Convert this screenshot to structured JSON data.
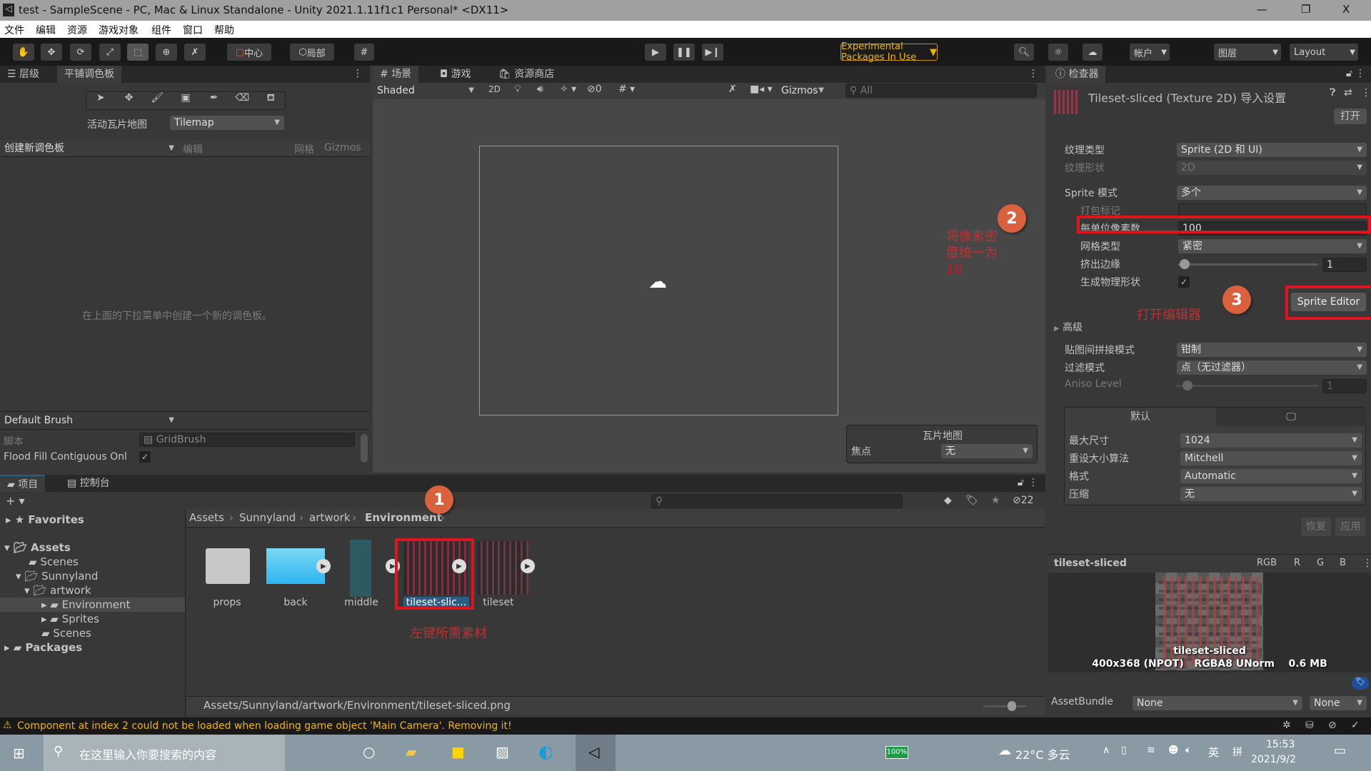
{
  "window": {
    "title": "test - SampleScene - PC, Mac & Linux Standalone - Unity 2021.1.11f1c1 Personal* <DX11>",
    "minimize": "—",
    "restore": "❐",
    "close": "X"
  },
  "menu": [
    "文件",
    "编辑",
    "资源",
    "游戏对象",
    "组件",
    "窗口",
    "帮助"
  ],
  "toolbar": {
    "pivot": "中心",
    "space": "局部",
    "experimental": "Experimental Packages In Use",
    "account": "帐户",
    "layers": "图层",
    "layout": "Layout"
  },
  "left_panel": {
    "tabs": [
      "层级",
      "平铺调色板"
    ],
    "active_tilemap_label": "活动瓦片地图",
    "active_tilemap_value": "Tilemap",
    "palette_dropdown": "创建新调色板",
    "edit": "编辑",
    "grid": "网格",
    "gizmos": "Gizmos",
    "empty_hint": "在上面的下拉菜单中创建一个新的调色板。",
    "brush": "Default Brush",
    "script_label": "脚本",
    "script_value": "GridBrush",
    "flood_fill_label": "Flood Fill Contiguous Onl",
    "flood_fill_checked": true
  },
  "scene": {
    "tabs": [
      "场景",
      "游戏",
      "资源商店"
    ],
    "shading": "Shaded",
    "mode_2d": "2D",
    "hidden_count": "0",
    "gizmos": "Gizmos",
    "search_placeholder": "All",
    "overlay": {
      "title": "瓦片地图",
      "focus_label": "焦点",
      "focus_value": "无"
    }
  },
  "annotations": {
    "step1": "1",
    "step1_text": "左键所需素材",
    "step2": "2",
    "step2_text_line1": "将像素密",
    "step2_text_line2": "度统一为",
    "step2_text_line3": "16",
    "step3": "3",
    "step3_text": "打开编辑器"
  },
  "inspector": {
    "tab": "检查器",
    "asset_title": "Tileset-sliced (Texture 2D) 导入设置",
    "open_button": "打开",
    "rows": [
      {
        "label": "纹理类型",
        "value": "Sprite (2D 和 UI)"
      },
      {
        "label": "纹理形状",
        "value": "2D"
      },
      {
        "label": "Sprite 模式",
        "value": "多个"
      },
      {
        "label": "打包标记",
        "value": ""
      },
      {
        "label": "每单位像素数",
        "value": "100"
      },
      {
        "label": "网格类型",
        "value": "紧密"
      },
      {
        "label": "挤出边缘",
        "value": "1"
      },
      {
        "label": "生成物理形状",
        "value": true
      }
    ],
    "extrude_slider": 0.0,
    "sprite_editor": "Sprite Editor",
    "advanced": "高级",
    "wrap_label": "贴图间拼接模式",
    "wrap_value": "钳制",
    "filter_label": "过滤模式",
    "filter_value": "点（无过滤器）",
    "aniso_label": "Aniso Level",
    "aniso_value": "1",
    "platform_tab": "默认",
    "platform_rows": [
      {
        "label": "最大尺寸",
        "value": "1024"
      },
      {
        "label": "重设大小算法",
        "value": "Mitchell"
      },
      {
        "label": "格式",
        "value": "Automatic"
      },
      {
        "label": "压缩",
        "value": "无"
      }
    ],
    "revert": "恢复",
    "apply": "应用",
    "preview_name": "tileset-sliced",
    "channels": [
      "RGB",
      "R",
      "G",
      "B"
    ],
    "preview_caption": "tileset-sliced",
    "preview_info": "400x368 (NPOT)   RGBA8 UNorm    0.6 MB",
    "assetbundle_label": "AssetBundle",
    "assetbundle_value": "None",
    "assetbundle_variant": "None"
  },
  "project": {
    "tabs": [
      "项目",
      "控制台"
    ],
    "hidden_count": "22",
    "tree": [
      {
        "label": "Favorites"
      },
      {
        "label": "Assets"
      },
      {
        "label": "Scenes"
      },
      {
        "label": "Sunnyland"
      },
      {
        "label": "artwork"
      },
      {
        "label": "Environment"
      },
      {
        "label": "Sprites"
      },
      {
        "label": "Scenes"
      },
      {
        "label": "Packages"
      }
    ],
    "breadcrumb": [
      "Assets",
      "Sunnyland",
      "artwork",
      "Environment"
    ],
    "items": [
      "props",
      "back",
      "middle",
      "tileset-slic...",
      "tileset"
    ],
    "path": "Assets/Sunnyland/artwork/Environment/tileset-sliced.png"
  },
  "status": {
    "message": "Component at index 2 could not be loaded when loading game object 'Main Camera'. Removing it!"
  },
  "taskbar": {
    "search_placeholder": "在这里输入你要搜索的内容",
    "battery": "100%",
    "weather": "22°C 多云",
    "ime": "英",
    "time": "15:53",
    "date": "2021/9/2"
  },
  "colors": {
    "accent_red": "#e0141e",
    "step_circle": "#d9613e",
    "warning": "#f0b400",
    "selection": "#2c5d87"
  }
}
